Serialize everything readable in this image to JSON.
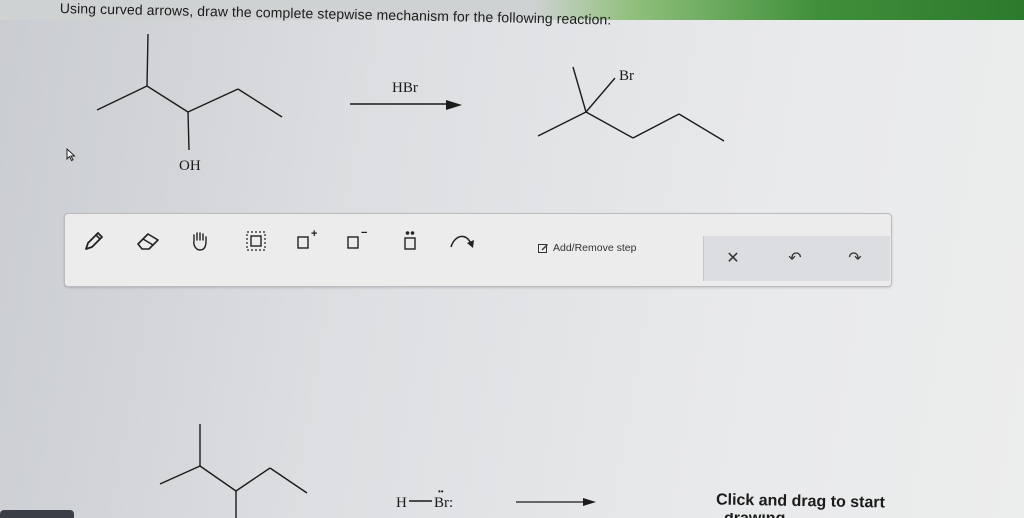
{
  "question": {
    "text": "Using curved arrows, draw the complete stepwise mechanism for the following reaction:"
  },
  "reaction": {
    "reagent": "HBr",
    "reactant_group_label": "OH",
    "product_group_label": "Br"
  },
  "toolbar": {
    "tools": [
      {
        "name": "pencil-icon"
      },
      {
        "name": "eraser-icon"
      },
      {
        "name": "hand-icon"
      },
      {
        "name": "select-box-icon"
      },
      {
        "name": "positive-charge-icon",
        "mark": "+"
      },
      {
        "name": "negative-charge-icon",
        "mark": "−"
      },
      {
        "name": "lone-pair-icon"
      },
      {
        "name": "curved-arrow-icon"
      }
    ],
    "add_remove_label": "Add/Remove step",
    "clear_symbol": "✕",
    "undo_symbol": "↶",
    "redo_symbol": "↷"
  },
  "canvas": {
    "h_label": "H",
    "br_label": "Br:",
    "lone_pair_dots": "••",
    "hint": "Click and drag to start",
    "hint_continuation": "drawing"
  },
  "colors": {
    "accent_green": "#2c7a2c",
    "toolbar_bg": "#ececec"
  }
}
